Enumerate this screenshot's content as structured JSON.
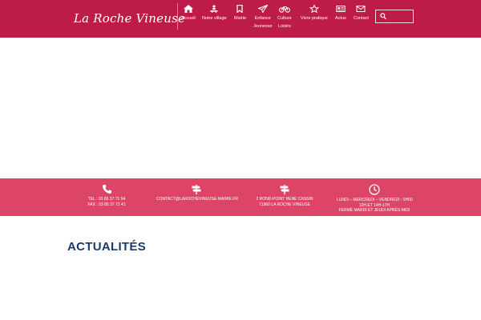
{
  "site": {
    "logo": "La Roche Vineuse"
  },
  "nav": {
    "items": [
      {
        "label": "Accueil",
        "icon": "home-icon"
      },
      {
        "label": "Notre village",
        "icon": "people-icon"
      },
      {
        "label": "Mairie",
        "icon": "bookmark-icon"
      },
      {
        "label": "Enfance",
        "label2": "Jeunesse",
        "icon": "paper-plane-icon"
      },
      {
        "label": "Culture",
        "label2": "Loisirs",
        "icon": "bicycle-icon"
      },
      {
        "label": "Vivre pratique",
        "icon": "star-icon"
      },
      {
        "label": "Actus",
        "icon": "newspaper-icon"
      },
      {
        "label": "Contact",
        "icon": "envelope-icon"
      }
    ],
    "search": {
      "placeholder": "",
      "icon": "search-icon"
    }
  },
  "contact_bar": {
    "phone": {
      "icon": "phone-icon",
      "line1": "TEL : 03 85 37 71 94",
      "line2": "FAX : 03 85 37 72 41"
    },
    "email": {
      "icon": "signpost-icon",
      "line1": "CONTACT@LAROCHEVINEUSE-MAIRIE.FR"
    },
    "address": {
      "icon": "signpost-icon",
      "line1": "2 ROND-POINT RENE CASSIN",
      "line2": "71960 LA ROCHE VINEUSE"
    },
    "hours": {
      "icon": "clock-icon",
      "line1": "LUNDI – MERCREDI – VENDREDI : 9H00",
      "line2": "12H ET 14H-17H",
      "line3": "FERMÉ MARDI ET JEUDI APRÈS-MIDI"
    }
  },
  "main": {
    "section_title": "ACTUALITÉS"
  },
  "colors": {
    "header_bg": "#bd1c48",
    "contact_bg": "#dc4566",
    "title": "#1b3a68"
  }
}
